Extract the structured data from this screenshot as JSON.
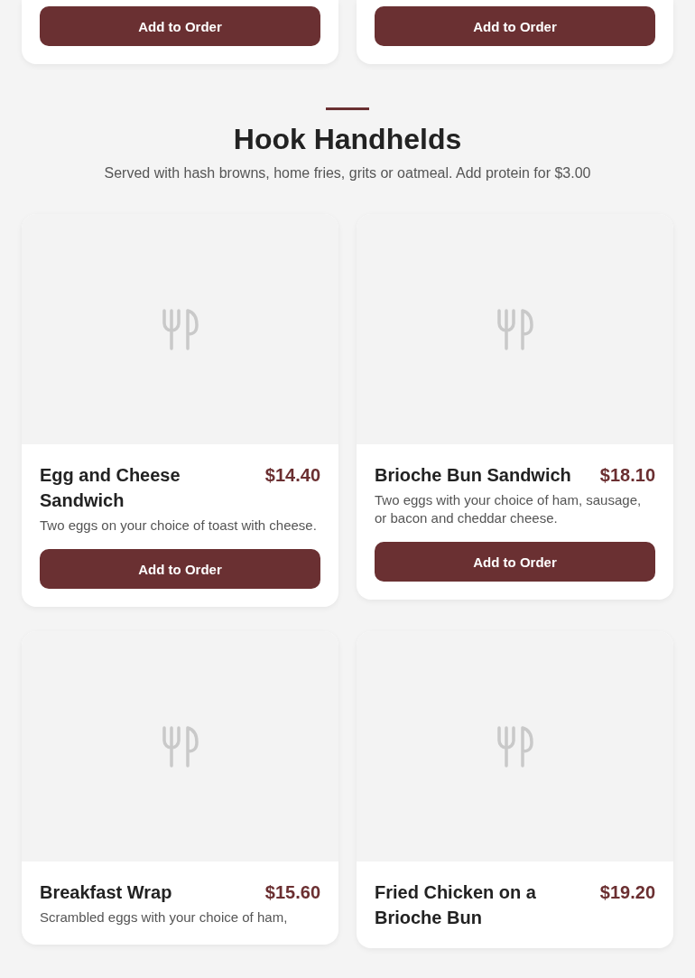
{
  "previous_items": [
    {
      "button": "Add to Order"
    },
    {
      "button": "Add to Order"
    }
  ],
  "section": {
    "title": "Hook Handhelds",
    "subtitle": "Served with hash browns, home fries, grits or oatmeal. Add protein for $3.00"
  },
  "items": [
    {
      "name": "Egg and Cheese Sandwich",
      "price": "$14.40",
      "description": "Two eggs on your choice of toast with cheese.",
      "button": "Add to Order"
    },
    {
      "name": "Brioche Bun Sandwich",
      "price": "$18.10",
      "description": "Two eggs with your choice of ham, sausage, or bacon and cheddar cheese.",
      "button": "Add to Order"
    },
    {
      "name": "Breakfast Wrap",
      "price": "$15.60",
      "description": "Scrambled eggs with your choice of ham,"
    },
    {
      "name": "Fried Chicken on a Brioche Bun",
      "price": "$19.20"
    }
  ]
}
